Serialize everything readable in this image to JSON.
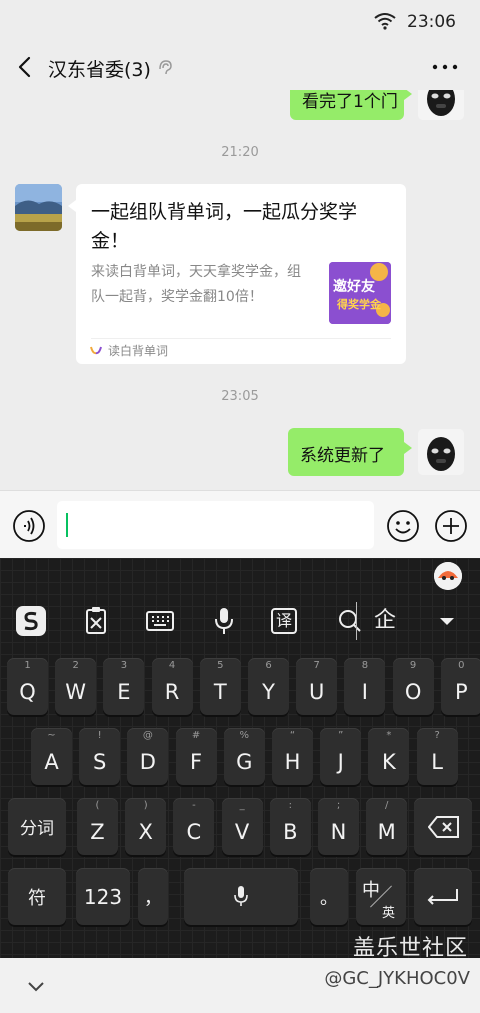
{
  "status": {
    "time": "23:06"
  },
  "title": {
    "chat_name": "汉东省委(3)"
  },
  "messages": {
    "partial_text": "看完了1个门",
    "time1": "21:20",
    "card": {
      "title": "一起组队背单词，一起瓜分奖学金！",
      "desc": "来读白背单词，天天拿奖学金，组队一起背，奖学金翻10倍！",
      "thumb_line1": "邀好友",
      "thumb_line2": "得奖学金",
      "source": "读白背单词"
    },
    "time2": "23:05",
    "sent_text": "系统更新了"
  },
  "keyboard": {
    "tools": {
      "translate": "译",
      "cloud": "企"
    },
    "row1": [
      {
        "letter": "Q",
        "num": "1"
      },
      {
        "letter": "W",
        "num": "2"
      },
      {
        "letter": "E",
        "num": "3"
      },
      {
        "letter": "R",
        "num": "4"
      },
      {
        "letter": "T",
        "num": "5"
      },
      {
        "letter": "Y",
        "num": "6"
      },
      {
        "letter": "U",
        "num": "7"
      },
      {
        "letter": "I",
        "num": "8"
      },
      {
        "letter": "O",
        "num": "9"
      },
      {
        "letter": "P",
        "num": "0"
      }
    ],
    "row2": [
      {
        "letter": "A",
        "num": "~"
      },
      {
        "letter": "S",
        "num": "!"
      },
      {
        "letter": "D",
        "num": "@"
      },
      {
        "letter": "F",
        "num": "#"
      },
      {
        "letter": "G",
        "num": "%"
      },
      {
        "letter": "H",
        "num": "“"
      },
      {
        "letter": "J",
        "num": "”"
      },
      {
        "letter": "K",
        "num": "*"
      },
      {
        "letter": "L",
        "num": "?"
      }
    ],
    "row3": [
      {
        "letter": "Z",
        "num": "("
      },
      {
        "letter": "X",
        "num": ")"
      },
      {
        "letter": "C",
        "num": "-"
      },
      {
        "letter": "V",
        "num": "_"
      },
      {
        "letter": "B",
        "num": ":"
      },
      {
        "letter": "N",
        "num": ";"
      },
      {
        "letter": "M",
        "num": "/"
      }
    ],
    "fenci": "分词",
    "symbol": "符",
    "num123": "123",
    "comma": "，",
    "period": "。",
    "zh": "中",
    "en": "英"
  },
  "watermark": {
    "brand": "盖乐世社区",
    "user": "@GC_JYKHOC0V"
  }
}
